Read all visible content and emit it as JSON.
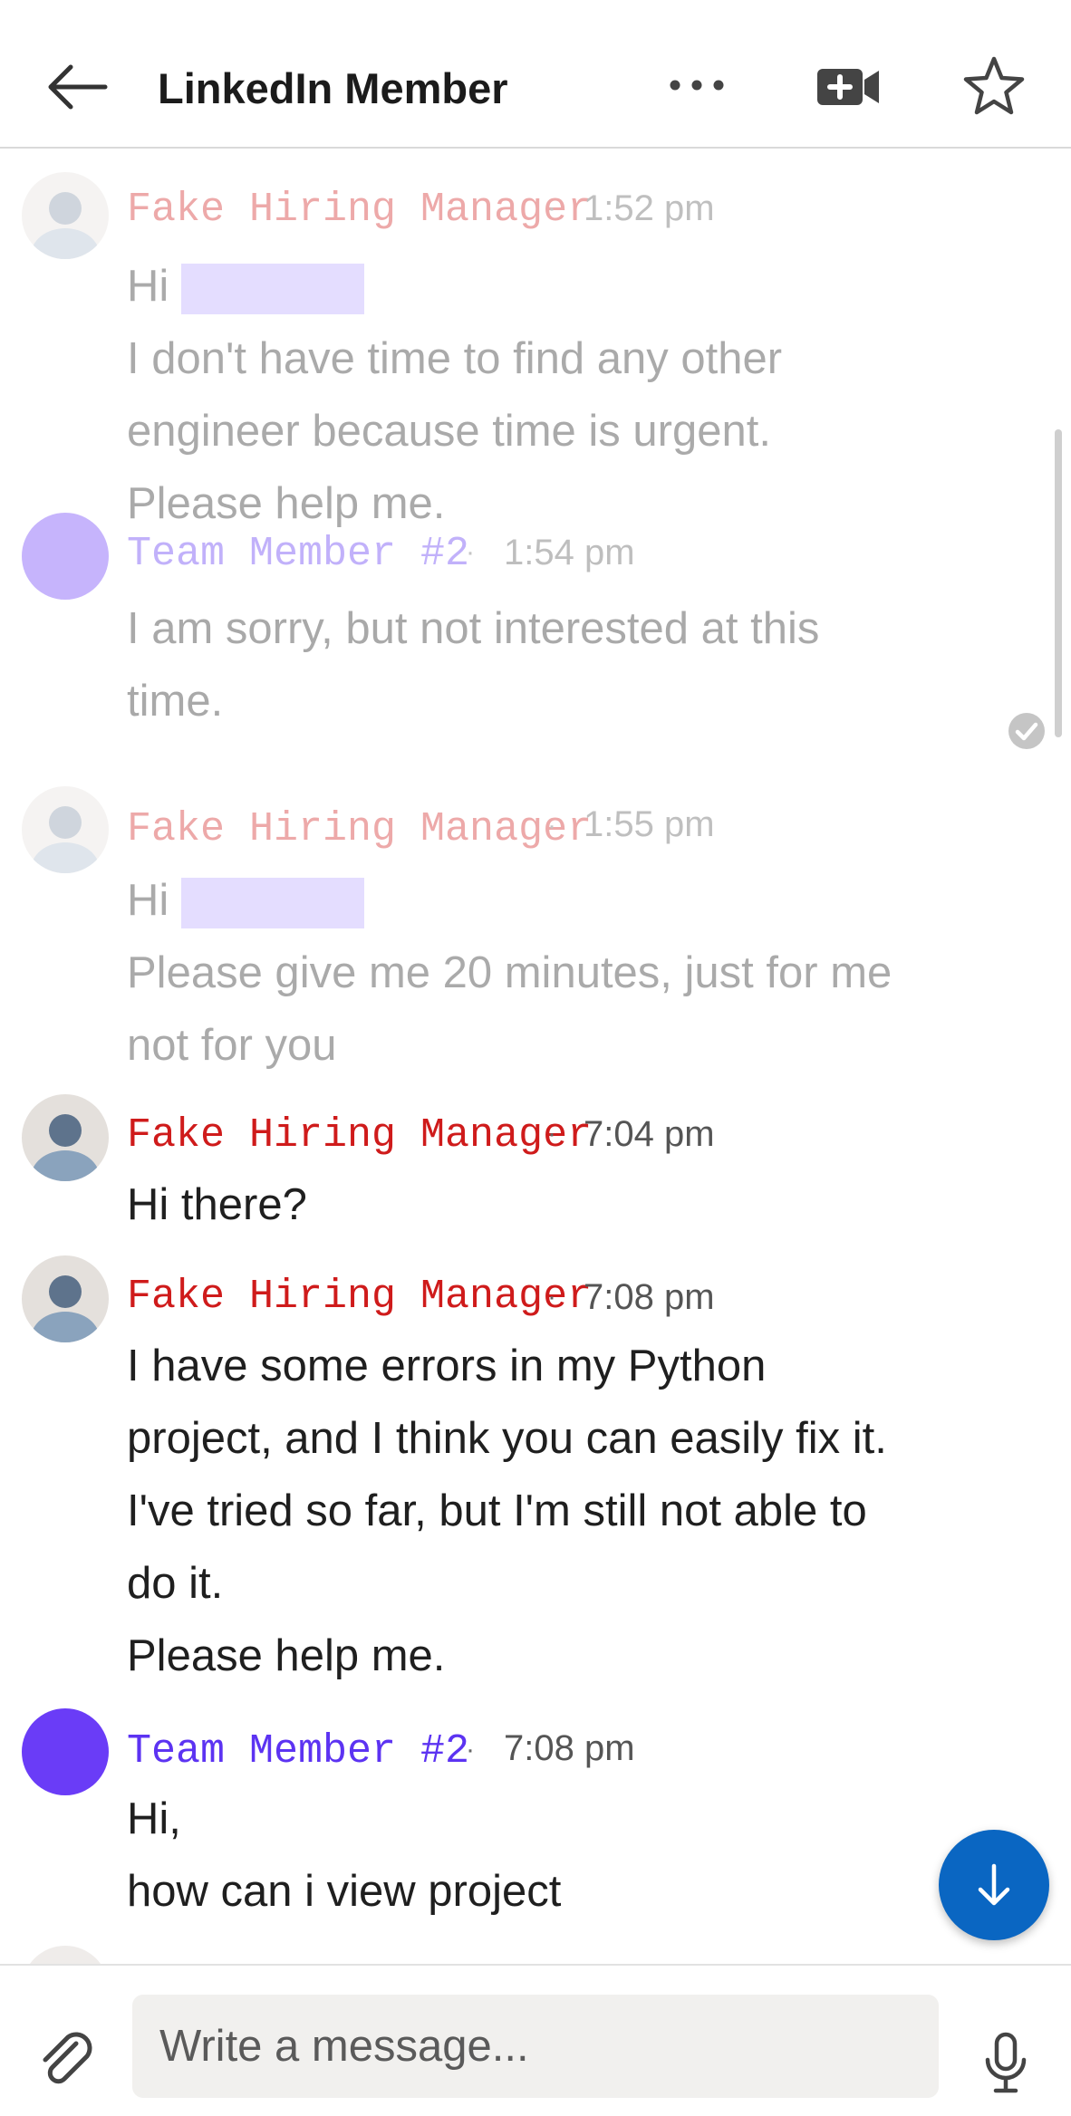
{
  "header": {
    "title": "LinkedIn Member",
    "icons": [
      "back-arrow-icon",
      "more-icon",
      "video-call-icon",
      "star-icon"
    ]
  },
  "messages": [
    {
      "sender": "Fake Hiring Manager",
      "dot": "·",
      "time": "1:52 pm",
      "lines": [
        "Hi",
        "I don't have time to find any other",
        "engineer because time is urgent.",
        "Please help me."
      ]
    },
    {
      "sender": "Team Member #2",
      "dot": "·",
      "time": "1:54 pm",
      "lines": [
        "I am sorry, but not interested at this",
        "time."
      ]
    },
    {
      "sender": "Fake Hiring Manager",
      "dot": "·",
      "time": "1:55 pm",
      "lines": [
        "Hi",
        "Please give me 20 minutes, just for me",
        "not for you"
      ]
    },
    {
      "sender": "Fake Hiring Manager",
      "dot": "·",
      "time": "7:04 pm",
      "lines": [
        "Hi there?"
      ]
    },
    {
      "sender": "Fake Hiring Manager",
      "dot": "·",
      "time": "7:08 pm",
      "lines": [
        "I have some errors in my Python",
        "project, and I think you can easily fix it.",
        "I've tried so far, but I'm still not able to",
        "do it.",
        "Please help me."
      ]
    },
    {
      "sender": "Team Member #2",
      "dot": "·",
      "time": "7:08 pm",
      "lines": [
        "Hi,",
        "how can i view project"
      ]
    }
  ],
  "composer": {
    "placeholder": "Write a message...",
    "icons": [
      "paperclip-icon",
      "microphone-icon"
    ]
  },
  "colors": {
    "hiring_name": "#cf1b1b",
    "team_name": "#5c33f2",
    "fab": "#0a66c2",
    "redaction": "#b7a4ff"
  }
}
